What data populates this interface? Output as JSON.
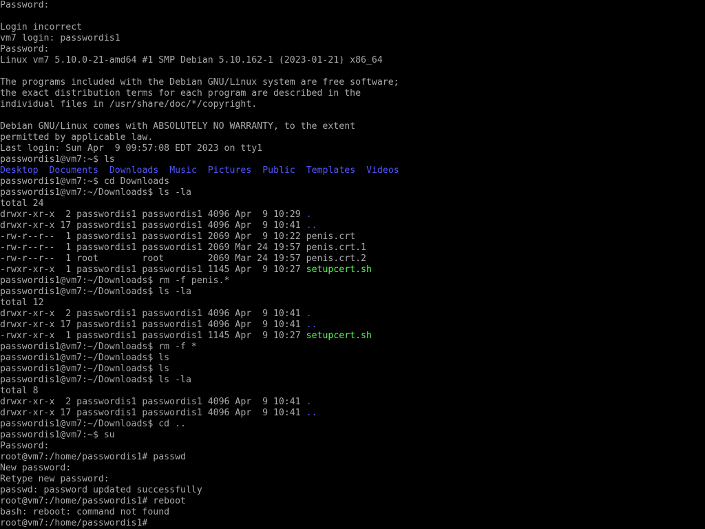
{
  "terminal": {
    "colors": {
      "background": "#000000",
      "text": "#aaaaaa",
      "directory": "#5555ff",
      "executable": "#55ff55"
    },
    "lines": [
      [
        {
          "t": "Password:"
        }
      ],
      [
        {
          "t": ""
        }
      ],
      [
        {
          "t": "Login incorrect"
        }
      ],
      [
        {
          "t": "vm7 login: passwordis1"
        }
      ],
      [
        {
          "t": "Password:"
        }
      ],
      [
        {
          "t": "Linux vm7 5.10.0-21-amd64 #1 SMP Debian 5.10.162-1 (2023-01-21) x86_64"
        }
      ],
      [
        {
          "t": ""
        }
      ],
      [
        {
          "t": "The programs included with the Debian GNU/Linux system are free software;"
        }
      ],
      [
        {
          "t": "the exact distribution terms for each program are described in the"
        }
      ],
      [
        {
          "t": "individual files in /usr/share/doc/*/copyright."
        }
      ],
      [
        {
          "t": ""
        }
      ],
      [
        {
          "t": "Debian GNU/Linux comes with ABSOLUTELY NO WARRANTY, to the extent"
        }
      ],
      [
        {
          "t": "permitted by applicable law."
        }
      ],
      [
        {
          "t": "Last login: Sun Apr  9 09:57:08 EDT 2023 on tty1"
        }
      ],
      [
        {
          "t": "passwordis1@vm7:~$ ls"
        }
      ],
      [
        {
          "t": "Desktop",
          "k": "dir"
        },
        {
          "t": "  "
        },
        {
          "t": "Documents",
          "k": "dir"
        },
        {
          "t": "  "
        },
        {
          "t": "Downloads",
          "k": "dir"
        },
        {
          "t": "  "
        },
        {
          "t": "Music",
          "k": "dir"
        },
        {
          "t": "  "
        },
        {
          "t": "Pictures",
          "k": "dir"
        },
        {
          "t": "  "
        },
        {
          "t": "Public",
          "k": "dir"
        },
        {
          "t": "  "
        },
        {
          "t": "Templates",
          "k": "dir"
        },
        {
          "t": "  "
        },
        {
          "t": "Videos",
          "k": "dir"
        }
      ],
      [
        {
          "t": "passwordis1@vm7:~$ cd Downloads"
        }
      ],
      [
        {
          "t": "passwordis1@vm7:~/Downloads$ ls -la"
        }
      ],
      [
        {
          "t": "total 24"
        }
      ],
      [
        {
          "t": "drwxr-xr-x  2 passwordis1 passwordis1 4096 Apr  9 10:29 "
        },
        {
          "t": ".",
          "k": "dir"
        }
      ],
      [
        {
          "t": "drwxr-xr-x 17 passwordis1 passwordis1 4096 Apr  9 10:41 "
        },
        {
          "t": "..",
          "k": "dir"
        }
      ],
      [
        {
          "t": "-rw-r--r--  1 passwordis1 passwordis1 2069 Apr  9 10:22 penis.crt"
        }
      ],
      [
        {
          "t": "-rw-r--r--  1 passwordis1 passwordis1 2069 Mar 24 19:57 penis.crt.1"
        }
      ],
      [
        {
          "t": "-rw-r--r--  1 root        root        2069 Mar 24 19:57 penis.crt.2"
        }
      ],
      [
        {
          "t": "-rwxr-xr-x  1 passwordis1 passwordis1 1145 Apr  9 10:27 "
        },
        {
          "t": "setupcert.sh",
          "k": "exec"
        }
      ],
      [
        {
          "t": "passwordis1@vm7:~/Downloads$ rm -f penis.*"
        }
      ],
      [
        {
          "t": "passwordis1@vm7:~/Downloads$ ls -la"
        }
      ],
      [
        {
          "t": "total 12"
        }
      ],
      [
        {
          "t": "drwxr-xr-x  2 passwordis1 passwordis1 4096 Apr  9 10:41 "
        },
        {
          "t": ".",
          "k": "dir"
        }
      ],
      [
        {
          "t": "drwxr-xr-x 17 passwordis1 passwordis1 4096 Apr  9 10:41 "
        },
        {
          "t": "..",
          "k": "dir"
        }
      ],
      [
        {
          "t": "-rwxr-xr-x  1 passwordis1 passwordis1 1145 Apr  9 10:27 "
        },
        {
          "t": "setupcert.sh",
          "k": "exec"
        }
      ],
      [
        {
          "t": "passwordis1@vm7:~/Downloads$ rm -f *"
        }
      ],
      [
        {
          "t": "passwordis1@vm7:~/Downloads$ ls"
        }
      ],
      [
        {
          "t": "passwordis1@vm7:~/Downloads$ ls"
        }
      ],
      [
        {
          "t": "passwordis1@vm7:~/Downloads$ ls -la"
        }
      ],
      [
        {
          "t": "total 8"
        }
      ],
      [
        {
          "t": "drwxr-xr-x  2 passwordis1 passwordis1 4096 Apr  9 10:41 "
        },
        {
          "t": ".",
          "k": "dir"
        }
      ],
      [
        {
          "t": "drwxr-xr-x 17 passwordis1 passwordis1 4096 Apr  9 10:41 "
        },
        {
          "t": "..",
          "k": "dir"
        }
      ],
      [
        {
          "t": "passwordis1@vm7:~/Downloads$ cd .."
        }
      ],
      [
        {
          "t": "passwordis1@vm7:~$ su"
        }
      ],
      [
        {
          "t": "Password:"
        }
      ],
      [
        {
          "t": "root@vm7:/home/passwordis1# passwd"
        }
      ],
      [
        {
          "t": "New password:"
        }
      ],
      [
        {
          "t": "Retype new password:"
        }
      ],
      [
        {
          "t": "passwd: password updated successfully"
        }
      ],
      [
        {
          "t": "root@vm7:/home/passwordis1# reboot"
        }
      ],
      [
        {
          "t": "bash: reboot: command not found"
        }
      ],
      [
        {
          "t": "root@vm7:/home/passwordis1#"
        }
      ]
    ]
  }
}
